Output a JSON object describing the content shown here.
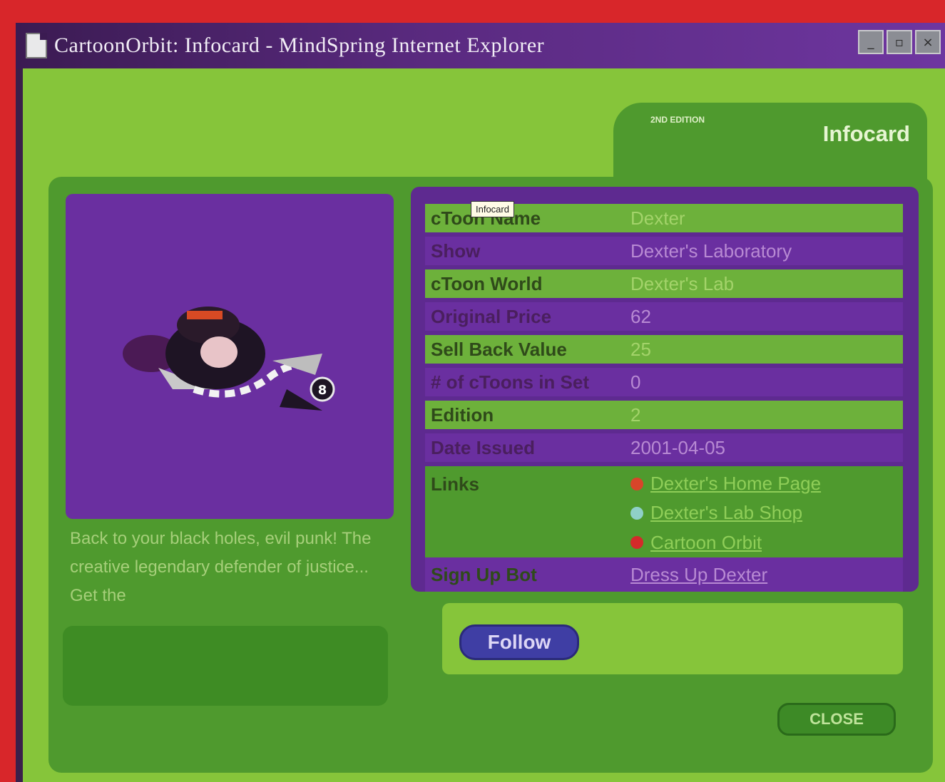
{
  "window": {
    "title": "CartoonOrbit: Infocard - MindSpring Internet Explorer",
    "controls": [
      "_",
      "▫",
      "×"
    ]
  },
  "tab": {
    "small_text": "2ND EDITION",
    "title": "Infocard"
  },
  "tooltip": "Infocard",
  "info_rows": [
    {
      "label": "cToon Name",
      "value": "Dexter"
    },
    {
      "label": "Show",
      "value": "Dexter's Laboratory"
    },
    {
      "label": "cToon World",
      "value": "Dexter's Lab"
    },
    {
      "label": "Original Price",
      "value": "62"
    },
    {
      "label": "Sell Back Value",
      "value": "25"
    },
    {
      "label": "# of cToons in Set",
      "value": "0"
    },
    {
      "label": "Edition",
      "value": "2"
    },
    {
      "label": "Date Issued",
      "value": "2001-04-05"
    }
  ],
  "links": {
    "label": "Links",
    "items": [
      {
        "text": "Dexter's Home Page",
        "color": "#d8452a"
      },
      {
        "text": "Dexter's Lab Shop",
        "color": "#8fd0c8"
      },
      {
        "text": "Cartoon Orbit",
        "color": "#d42a2a"
      }
    ]
  },
  "signup": {
    "label": "Sign Up Bot",
    "link": "Dress Up Dexter"
  },
  "description": "Back to your black holes, evil punk! The creative legendary defender of justice... Get the",
  "buttons": {
    "follow": "Follow",
    "close": "CLOSE"
  },
  "character_badge": "8",
  "colors": {
    "background_red": "#d8262a",
    "green": "#86c53a",
    "dark_green": "#4f9a2e",
    "purple": "#6a2fa0",
    "titlebar": "#5a2a80"
  }
}
